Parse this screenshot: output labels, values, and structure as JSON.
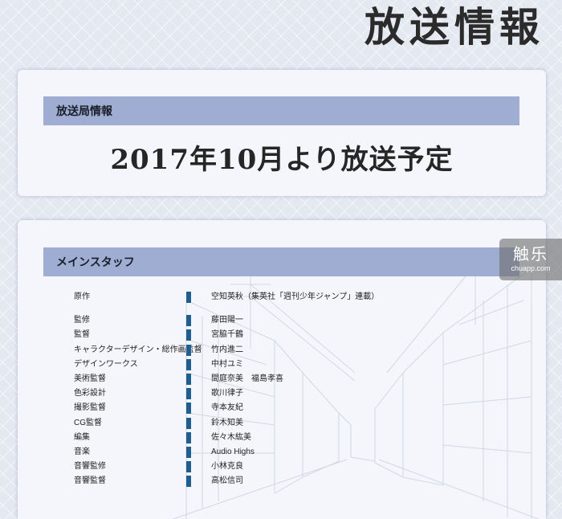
{
  "page": {
    "title": "放送情報"
  },
  "broadcast": {
    "header": "放送局情報",
    "schedule": "2017年10月より放送予定"
  },
  "staff": {
    "header": "メインスタッフ",
    "rows": [
      {
        "role": "原作",
        "name": "空知英秋（集英社「週刊少年ジャンプ」連載）"
      },
      {
        "role": "監修",
        "name": "藤田陽一"
      },
      {
        "role": "監督",
        "name": "宮脇千鶴"
      },
      {
        "role": "キャラクターデザイン・総作画監督",
        "name": "竹内進二"
      },
      {
        "role": "デザインワークス",
        "name": "中村ユミ"
      },
      {
        "role": "美術監督",
        "name": "間庭奈美　福島孝喜"
      },
      {
        "role": "色彩設計",
        "name": "歌川律子"
      },
      {
        "role": "撮影監督",
        "name": "寺本友紀"
      },
      {
        "role": "CG監督",
        "name": "鈴木知美"
      },
      {
        "role": "編集",
        "name": "佐々木紘美"
      },
      {
        "role": "音楽",
        "name": "Audio Highs"
      },
      {
        "role": "音響監修",
        "name": "小林克良"
      },
      {
        "role": "音響監督",
        "name": "高松信司"
      }
    ]
  },
  "watermark": {
    "main": "触乐",
    "sub": "chuapp.com"
  },
  "colors": {
    "header_band": "#9eadd1",
    "staff_bar": "#1f5f8f",
    "card_bg": "#f4f6fb"
  }
}
